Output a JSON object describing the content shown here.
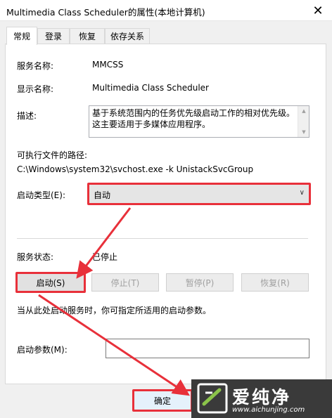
{
  "window": {
    "title": "Multimedia Class Scheduler的属性(本地计算机)"
  },
  "tabs": [
    {
      "label": "常规"
    },
    {
      "label": "登录"
    },
    {
      "label": "恢复"
    },
    {
      "label": "依存关系"
    }
  ],
  "general": {
    "service_name_label": "服务名称:",
    "service_name_value": "MMCSS",
    "display_name_label": "显示名称:",
    "display_name_value": "Multimedia Class Scheduler",
    "description_label": "描述:",
    "description_value": "基于系统范围内的任务优先级启动工作的相对优先级。这主要适用于多媒体应用程序。",
    "exe_path_label": "可执行文件的路径:",
    "exe_path_value": "C:\\Windows\\system32\\svchost.exe -k UnistackSvcGroup",
    "startup_type_label": "启动类型(E):",
    "startup_type_value": "自动",
    "service_status_label": "服务状态:",
    "service_status_value": "已停止",
    "buttons": {
      "start": "启动(S)",
      "stop": "停止(T)",
      "pause": "暂停(P)",
      "resume": "恢复(R)"
    },
    "hint_text": "当从此处启动服务时，你可指定所适用的启动参数。",
    "start_params_label": "启动参数(M):",
    "start_params_value": ""
  },
  "footer": {
    "ok_label": "确定"
  },
  "watermark": {
    "title": "爱纯净",
    "url": "www.aichunjing.com"
  },
  "colors": {
    "highlight": "#e8303a",
    "watermark_bg": "#3a3a3a"
  }
}
